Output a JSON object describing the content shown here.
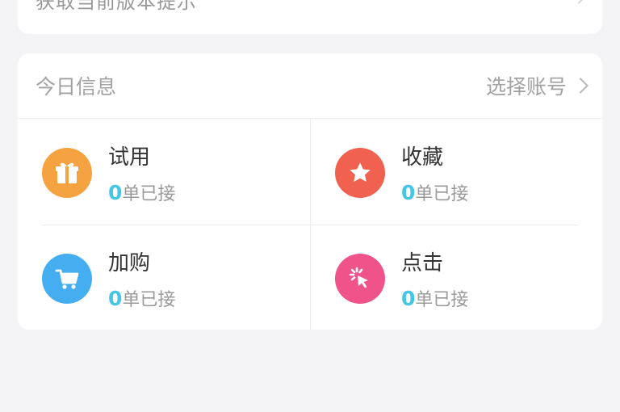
{
  "top_card": {
    "partial_text": "获取当前版本提示"
  },
  "info": {
    "title": "今日信息",
    "select_account": "选择账号",
    "items": [
      {
        "label": "试用",
        "count": "0",
        "suffix": "单已接",
        "icon": "gift-icon",
        "color": "#f5a340"
      },
      {
        "label": "收藏",
        "count": "0",
        "suffix": "单已接",
        "icon": "star-icon",
        "color": "#f0624f"
      },
      {
        "label": "加购",
        "count": "0",
        "suffix": "单已接",
        "icon": "cart-icon",
        "color": "#45aef0"
      },
      {
        "label": "点击",
        "count": "0",
        "suffix": "单已接",
        "icon": "click-icon",
        "color": "#f0528a"
      }
    ]
  }
}
